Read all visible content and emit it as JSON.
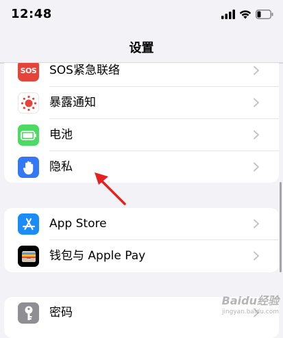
{
  "status_bar": {
    "time": "12:48"
  },
  "nav": {
    "title": "设置"
  },
  "group1": {
    "items": [
      {
        "label": "SOS紧急联络",
        "icon": "sos-icon",
        "icon_text": "SOS",
        "color": "#e5443a"
      },
      {
        "label": "暴露通知",
        "icon": "exposure-notification-icon",
        "color": "#ffffff"
      },
      {
        "label": "电池",
        "icon": "battery-icon",
        "color": "#4cd964"
      },
      {
        "label": "隐私",
        "icon": "hand-icon",
        "color": "#3478f6"
      }
    ]
  },
  "group2": {
    "items": [
      {
        "label": "App Store",
        "icon": "app-store-icon",
        "color": "#1b8cf5"
      },
      {
        "label": "钱包与 Apple Pay",
        "icon": "wallet-icon",
        "color": "#000000"
      }
    ]
  },
  "group3": {
    "items": [
      {
        "label": "密码",
        "icon": "key-icon",
        "color": "#8e8e93"
      }
    ]
  },
  "watermark": {
    "text": "Baidu经验",
    "subtext": "jingyan.baidu.com"
  }
}
